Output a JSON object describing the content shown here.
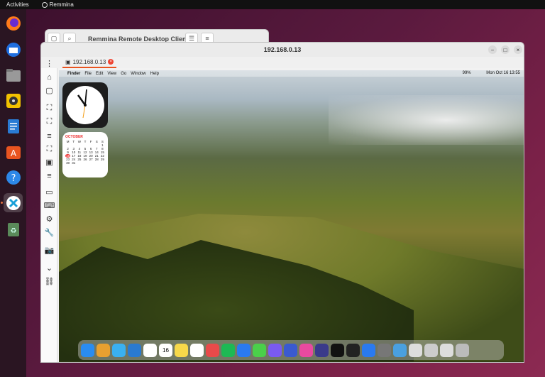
{
  "topbar": {
    "activities": "Activities",
    "app_name": "Remmina"
  },
  "dock": {
    "items": [
      "firefox-icon",
      "thunderbird-icon",
      "files-icon",
      "rhythmbox-icon",
      "writer-icon",
      "software-icon",
      "help-icon",
      "remmina-icon",
      "trash-icon"
    ]
  },
  "back_window": {
    "title": "Remmina Remote Desktop Client"
  },
  "main_window": {
    "title": "192.168.0.13",
    "tab_label": "192.168.0.13"
  },
  "remote": {
    "menubar": [
      "Finder",
      "File",
      "Edit",
      "View",
      "Go",
      "Window",
      "Help"
    ],
    "status_right": "Mon Oct 16  13:55",
    "battery": "99%",
    "calendar": {
      "month": "OCTOBER",
      "weekdays": [
        "M",
        "T",
        "W",
        "T",
        "F",
        "S",
        "S"
      ],
      "days": [
        "",
        "",
        "",
        "",
        "",
        "",
        "1",
        "2",
        "3",
        "4",
        "5",
        "6",
        "7",
        "8",
        "9",
        "10",
        "11",
        "12",
        "13",
        "14",
        "15",
        "16",
        "17",
        "18",
        "19",
        "20",
        "21",
        "22",
        "23",
        "24",
        "25",
        "26",
        "27",
        "28",
        "29",
        "30",
        "31",
        "",
        "",
        "",
        ""
      ],
      "today": "16"
    },
    "dock_date": "16"
  },
  "colors": {
    "accent": "#e95420",
    "close_red": "#ee3322"
  }
}
